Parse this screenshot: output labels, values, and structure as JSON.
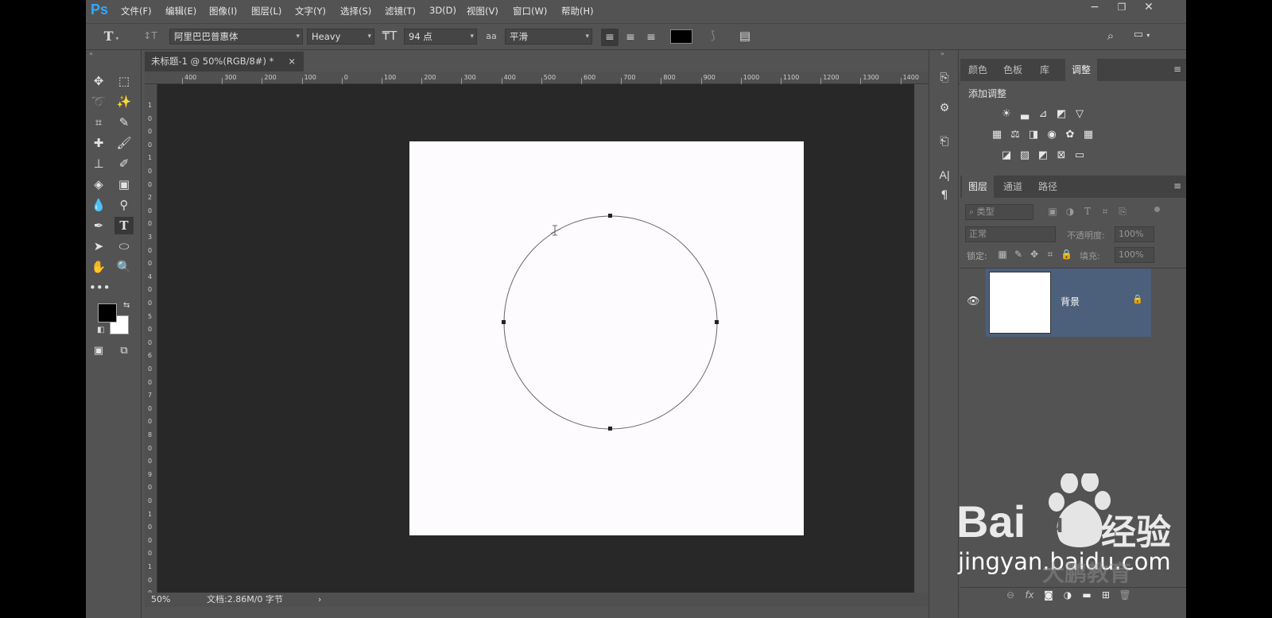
{
  "app": {
    "logo": "Ps"
  },
  "menu": [
    "文件(F)",
    "编辑(E)",
    "图像(I)",
    "图层(L)",
    "文字(Y)",
    "选择(S)",
    "滤镜(T)",
    "3D(D)",
    "视图(V)",
    "窗口(W)",
    "帮助(H)"
  ],
  "options": {
    "tool_glyph": "T",
    "font_family": "阿里巴巴普惠体",
    "font_style": "Heavy",
    "font_size": "94 点",
    "aa_label": "aa",
    "anti_alias": "平滑",
    "color": "#000000"
  },
  "document": {
    "tab_title": "未标题-1 @ 50%(RGB/8#) *",
    "close": "×",
    "ruler_top": [
      "400",
      "300",
      "200",
      "100",
      "0",
      "100",
      "200",
      "300",
      "400",
      "500",
      "600",
      "700",
      "800",
      "900",
      "1000",
      "1100",
      "1200",
      "1300",
      "1400"
    ],
    "ruler_left": [
      "1",
      "0",
      "0",
      "0",
      "1",
      "0",
      "0",
      "2",
      "0",
      "0",
      "3",
      "0",
      "0",
      "4",
      "0",
      "0",
      "5",
      "0",
      "0",
      "6",
      "0",
      "0",
      "7",
      "0",
      "0",
      "8",
      "0",
      "0",
      "9",
      "0",
      "0",
      "1",
      "0",
      "0",
      "0",
      "1",
      "0",
      "0"
    ],
    "zoom": "50%",
    "doc_info": "文档:2.86M/0 字节",
    "arrow": "›"
  },
  "panels": {
    "top_tabs": [
      "颜色",
      "色板",
      "库",
      "调整"
    ],
    "active_top_tab": "调整",
    "adjust_title": "添加调整",
    "layer_tabs": [
      "图层",
      "通道",
      "路径"
    ],
    "filter_kind": "类型",
    "blend_mode": "正常",
    "opacity_label": "不透明度:",
    "opacity_value": "100%",
    "lock_label": "锁定:",
    "fill_label": "填充:",
    "fill_value": "100%",
    "layers": [
      {
        "name": "背景",
        "visible": true,
        "locked": true
      }
    ]
  },
  "watermark": {
    "logo_bai": "Bai",
    "logo_du": "du",
    "logo_suffix": "经验",
    "url": "jingyan.baidu.com",
    "overlay": "大鹏教育"
  }
}
